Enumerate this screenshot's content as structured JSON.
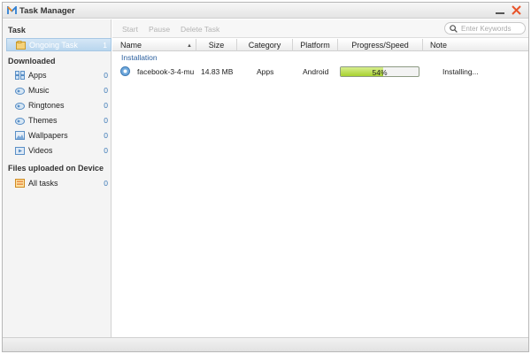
{
  "window": {
    "title": "Task Manager"
  },
  "colors": {
    "accent": "#3a78b6",
    "selected": "#b9d6ee",
    "progress": "#a7d12e",
    "close": "#e8542a"
  },
  "sidebar": {
    "task_title": "Task",
    "task_items": [
      {
        "label": "Ongoing Task",
        "count": "1",
        "icon": "task-folder-icon",
        "active": true
      }
    ],
    "downloaded_title": "Downloaded",
    "downloaded_items": [
      {
        "label": "Apps",
        "count": "0",
        "icon": "apps-grid-icon"
      },
      {
        "label": "Music",
        "count": "0",
        "icon": "music-icon"
      },
      {
        "label": "Ringtones",
        "count": "0",
        "icon": "ringtone-icon"
      },
      {
        "label": "Themes",
        "count": "0",
        "icon": "theme-icon"
      },
      {
        "label": "Wallpapers",
        "count": "0",
        "icon": "wallpaper-icon"
      },
      {
        "label": "Videos",
        "count": "0",
        "icon": "video-icon"
      }
    ],
    "device_title": "Files uploaded on Device",
    "device_items": [
      {
        "label": "All tasks",
        "count": "0",
        "icon": "all-tasks-icon"
      }
    ]
  },
  "toolbar": {
    "start_label": "Start",
    "pause_label": "Pause",
    "delete_label": "Delete Task",
    "search_placeholder": "Enter Keywords"
  },
  "table": {
    "columns": [
      "Name",
      "Size",
      "Category",
      "Platform",
      "Progress/Speed",
      "Note"
    ],
    "group_label": "Installation",
    "rows": [
      {
        "name": "facebook-3-4-mu...",
        "size": "14.83 MB",
        "category": "Apps",
        "platform": "Android",
        "progress_text": "54%",
        "progress_fraction": 0.54,
        "note": "Installing..."
      }
    ]
  }
}
